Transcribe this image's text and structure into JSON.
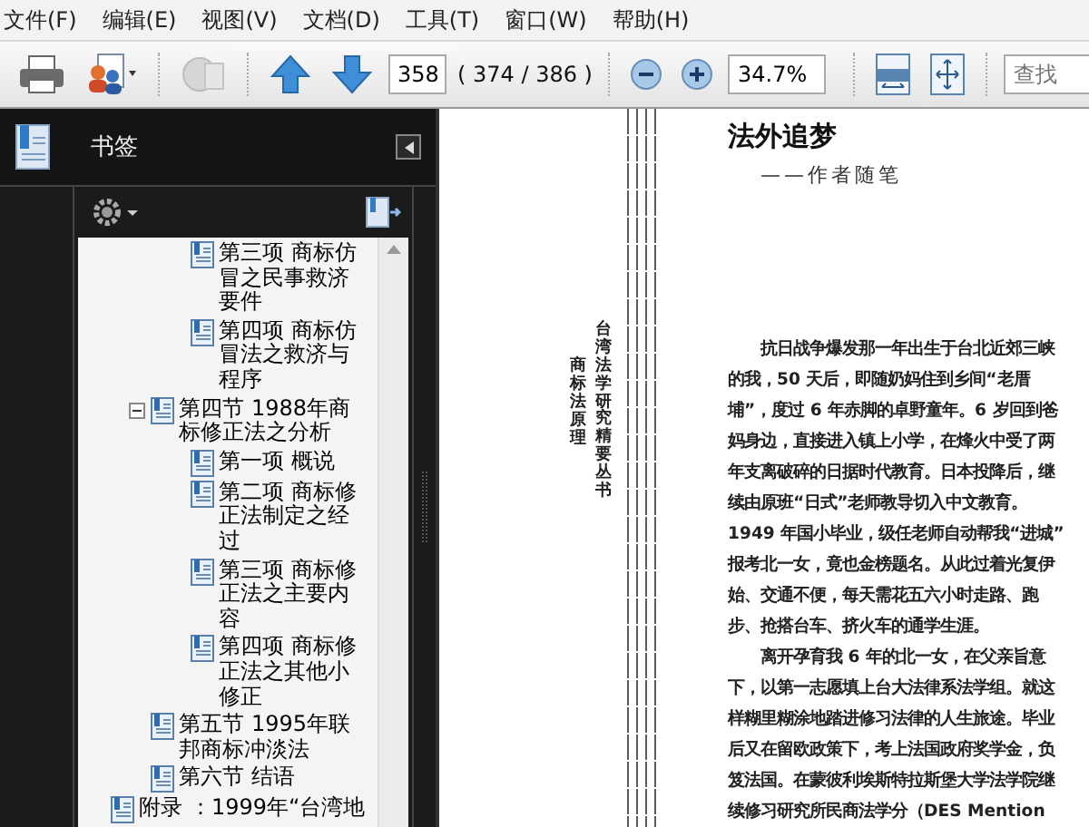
{
  "menu": [
    "文件(F)",
    "编辑(E)",
    "视图(V)",
    "文档(D)",
    "工具(T)",
    "窗口(W)",
    "帮助(H)"
  ],
  "toolbar": {
    "page": "358",
    "page_count": "( 374 / 386 )",
    "zoom": "34.7%",
    "search": {
      "placeholder": "查找"
    }
  },
  "bookmarks": {
    "title": "书签",
    "tree": [
      {
        "children": [
          {
            "children": [
              {
                "label": "第三项  商标仿冒之民事救济要件"
              },
              {
                "label": "第四项  商标仿冒法之救济与程序"
              }
            ]
          },
          {
            "label": "第四节  1988年商标修正法之分析",
            "expanded": true,
            "children": [
              {
                "label": "第一项  概说"
              },
              {
                "label": "第二项  商标修正法制定之经过"
              },
              {
                "label": "第三项  商标修正法之主要内容"
              },
              {
                "label": "第四项  商标修正法之其他小修正"
              }
            ]
          },
          {
            "label": "第五节  1995年联邦商标冲淡法"
          },
          {
            "label": "第六节  结语"
          }
        ]
      },
      {
        "label": "附录 ：1999年“台湾地"
      }
    ]
  },
  "document": {
    "series": "台湾法学研究精要丛书",
    "book": "商标法原理",
    "title": "法外追梦",
    "subtitle": "——作者随笔",
    "paragraphs": [
      [
        "抗日战争爆发那一年出生于台北近郊三峡",
        "的我，50 天后，即随奶妈住到乡间“老厝",
        "埔”，度过 6 年赤脚的卓野童年。6 岁回到爸",
        "妈身边，直接进入镇上小学，在烽火中受了两",
        "年支离破碎的日据时代教育。日本投降后，继",
        "续由原班“日式”老师教导切入中文教育。",
        "1949 年国小毕业，级任老师自动帮我“进城”",
        "报考北一女，竟也金榜题名。从此过着光复伊",
        "始、交通不便，每天需花五六小时走路、跑",
        "步、抢搭台车、挤火车的通学生涯。"
      ],
      [
        "离开孕育我 6 年的北一女，在父亲旨意",
        "下，以第一志愿填上台大法律系法学组。就这",
        "样糊里糊涂地踏进修习法律的人生旅途。毕业",
        "后又在留欧政策下，考上法国政府奖学金，负",
        "笈法国。在蒙彼利埃斯特拉斯堡大学法学院继",
        "续修习研究所民商法学分（DES Mention"
      ]
    ]
  }
}
